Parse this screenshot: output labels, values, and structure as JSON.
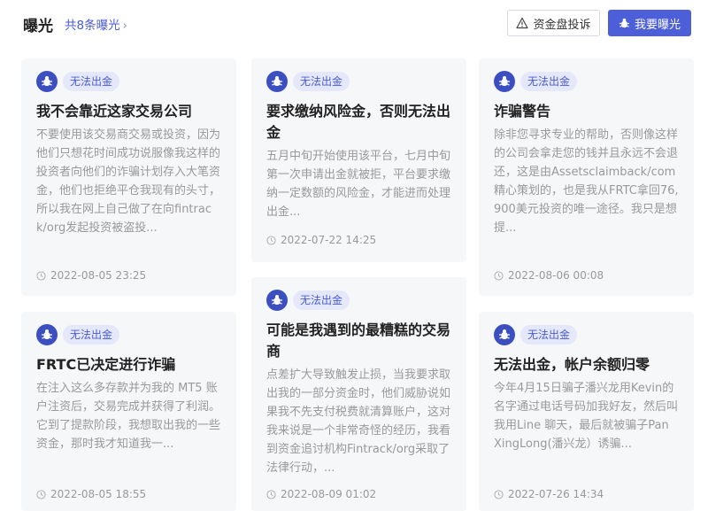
{
  "header": {
    "title": "曝光",
    "count_link": "共8条曝光",
    "complain_button": "资金盘投诉",
    "expose_button": "我要曝光"
  },
  "cards": [
    {
      "tag": "无法出金",
      "title": "我不会靠近这家交易公司",
      "desc": "不要使用该交易商交易或投资，因为他们只想花时间成功说服像我这样的投资者向他们的诈骗计划存入大笔资金，他们也拒绝平仓我现有的头寸，所以我在网上自己做了在向fintrack/org发起投资被盗投...",
      "date": "2022-08-05 23:25"
    },
    {
      "tag": "无法出金",
      "title": "要求缴纳风险金，否则无法出金",
      "desc": "五月中旬开始使用该平台，七月中旬第一次申请出金就被拒，平台要求缴纳一定数额的风险金，才能进而处理出金...",
      "date": "2022-07-22 14:25"
    },
    {
      "tag": "无法出金",
      "title": "诈骗警告",
      "desc": "除非您寻求专业的帮助，否则像这样的公司会拿走您的钱并且永远不会退还，这是由Assetsclaimback/com精心策划的，也是我从FRTC拿回76,900美元投资的唯一途径。我只是想提...",
      "date": "2022-08-06 00:08"
    },
    {
      "tag": "无法出金",
      "title": "FRTC已决定进行诈骗",
      "desc": "在注入这么多存款并为我的 MT5 账户注资后，交易完成并获得了利润。它到了提款阶段，我想取出我的一些资金，那时我才知道我一...",
      "date": "2022-08-05 18:55"
    },
    {
      "tag": "无法出金",
      "title": "可能是我遇到的最糟糕的交易商",
      "desc": "点差扩大导致触发止损，当我要求取出我的一部分资金时，他们威胁说如果我不先支付税费就清算账户，这对我来说是一个非常奇怪的经历，我看到资金追讨机构Fintrack/org采取了法律行动，...",
      "date": "2022-08-09 01:02"
    },
    {
      "tag": "无法出金",
      "title": "无法出金，帐户余额归零",
      "desc": "今年4月15日骗子潘兴龙用Kevin的名字通过电话号码加我好友，然后叫我用Line 聊天，最后就被骗子Pan XingLong(潘兴龙）诱骗...",
      "date": "2022-07-26 14:34"
    }
  ]
}
